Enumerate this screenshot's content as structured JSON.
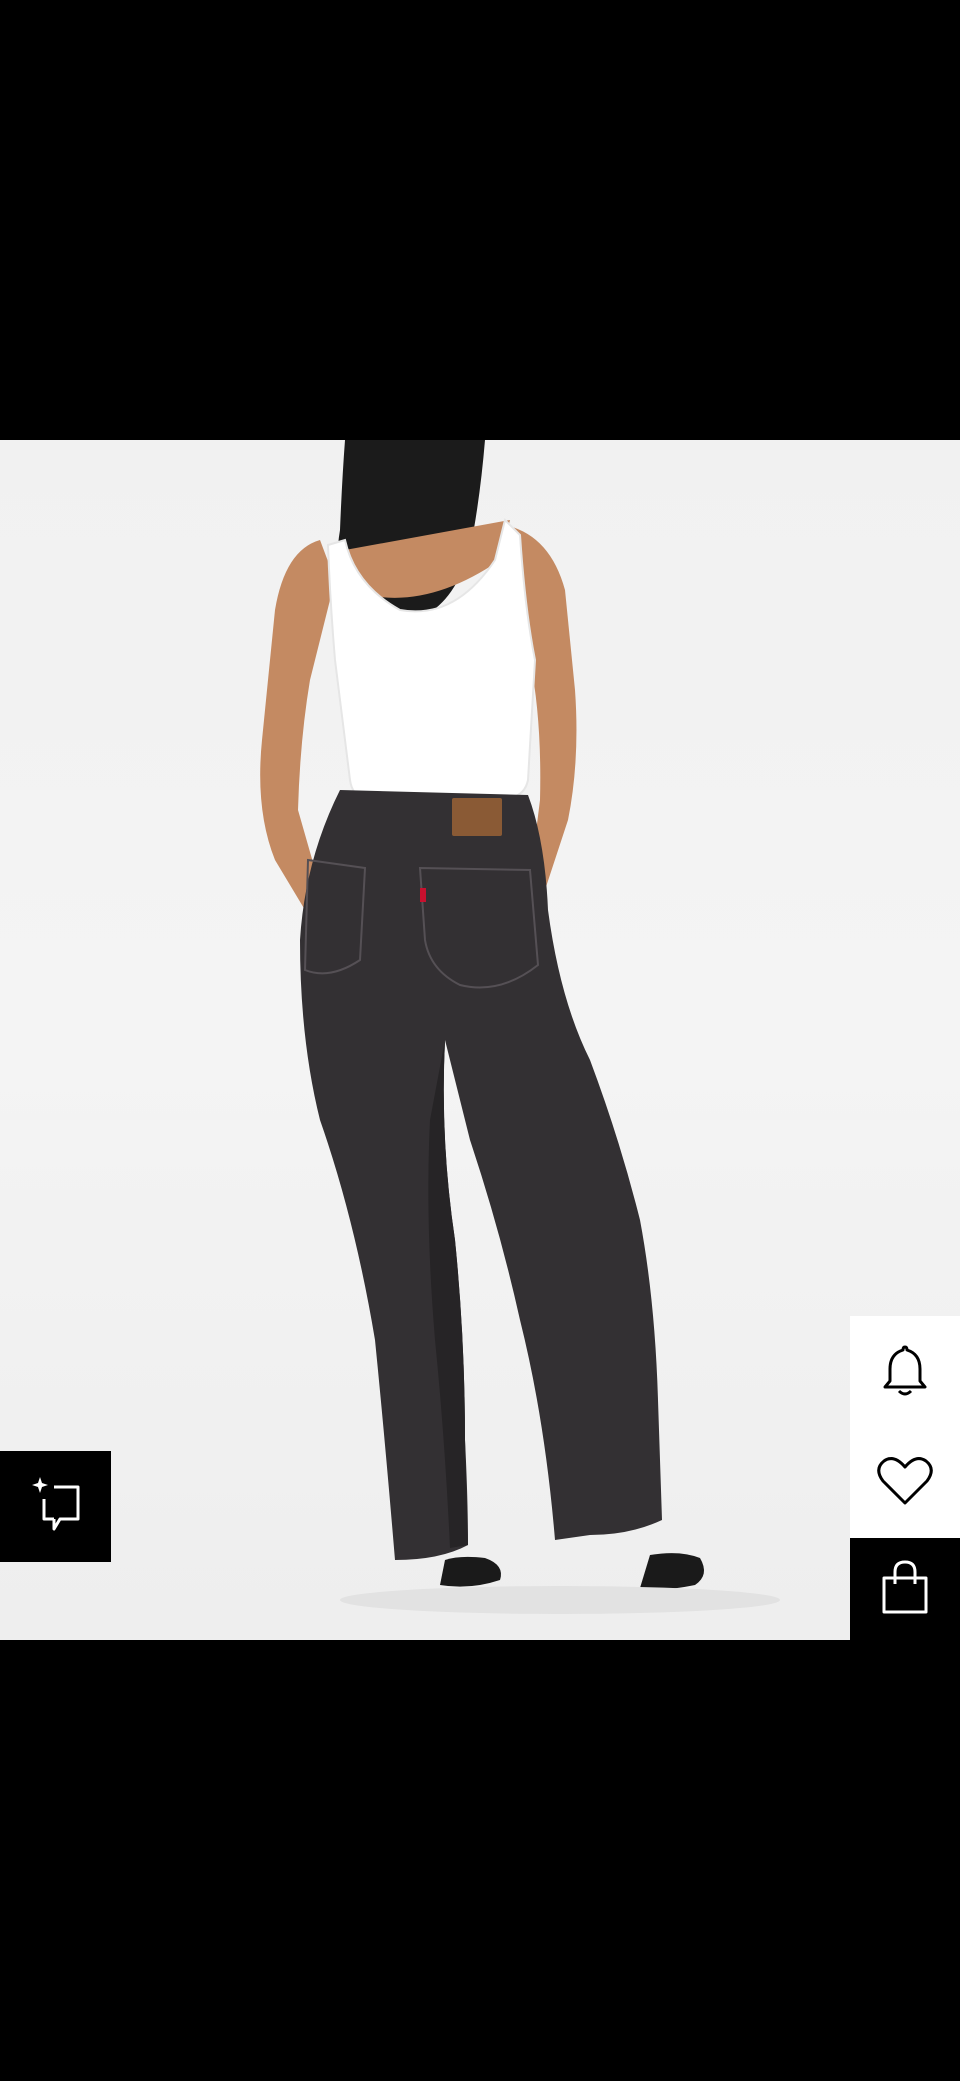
{
  "screen": {
    "background_color": "#000000",
    "photo_background_color": "#f2f2f2"
  },
  "product_image": {
    "subject": "model-back-view-black-straight-jeans",
    "top_color": "#ffffff",
    "jeans_color": "#333033",
    "patch_color": "#8a5a35",
    "tab_color": "#c8102e",
    "boots_color": "#1a1a1a"
  },
  "actions": {
    "visual_search_icon": "sparkle-frame-icon",
    "notify_icon": "bell-icon",
    "wishlist_icon": "heart-icon",
    "bag_icon": "shopping-bag-icon"
  }
}
